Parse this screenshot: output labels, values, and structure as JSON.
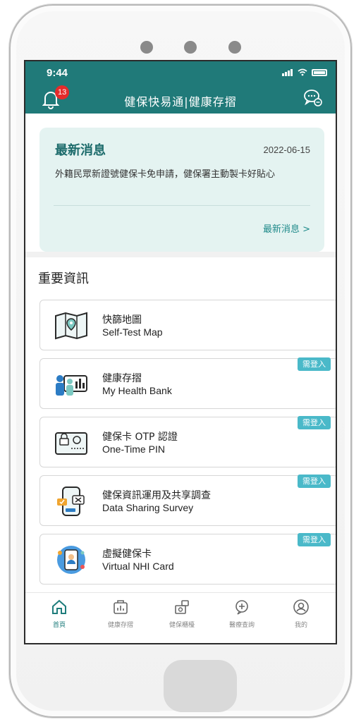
{
  "status": {
    "time": "9:44"
  },
  "header": {
    "title": "健保快易通|健康存摺",
    "notification_count": "13"
  },
  "news": {
    "title": "最新消息",
    "date": "2022-06-15",
    "body": "外籍民眾新證號健保卡免申請，健保署主動製卡好貼心",
    "more_link": "最新消息 >"
  },
  "section": {
    "title": "重要資訊"
  },
  "items": [
    {
      "zh": "快篩地圖",
      "en": "Self-Test Map",
      "login_required": "",
      "icon": "map-icon"
    },
    {
      "zh": "健康存摺",
      "en": "My Health Bank",
      "login_required": "需登入",
      "icon": "health-bank-icon"
    },
    {
      "zh": "健保卡 OTP 認證",
      "en": "One-Time PIN",
      "login_required": "需登入",
      "icon": "otp-card-icon"
    },
    {
      "zh": "健保資訊運用及共享調查",
      "en": "Data Sharing Survey",
      "login_required": "需登入",
      "icon": "survey-phone-icon"
    },
    {
      "zh": "虛擬健保卡",
      "en": "Virtual NHI Card",
      "login_required": "需登入",
      "icon": "virtual-card-icon"
    }
  ],
  "nav": [
    {
      "label": "首頁",
      "icon": "home-icon",
      "active": true
    },
    {
      "label": "健康存摺",
      "icon": "health-bank-icon",
      "active": false
    },
    {
      "label": "健保櫃檯",
      "icon": "counter-icon",
      "active": false
    },
    {
      "label": "醫療查詢",
      "icon": "medical-search-icon",
      "active": false
    },
    {
      "label": "我的",
      "icon": "profile-icon",
      "active": false
    }
  ],
  "colors": {
    "header": "#207a79",
    "news_bg": "#e4f3f1",
    "accent": "#1f8a8a",
    "badge": "#e52b2b",
    "login_tag": "#4ab9c9"
  }
}
